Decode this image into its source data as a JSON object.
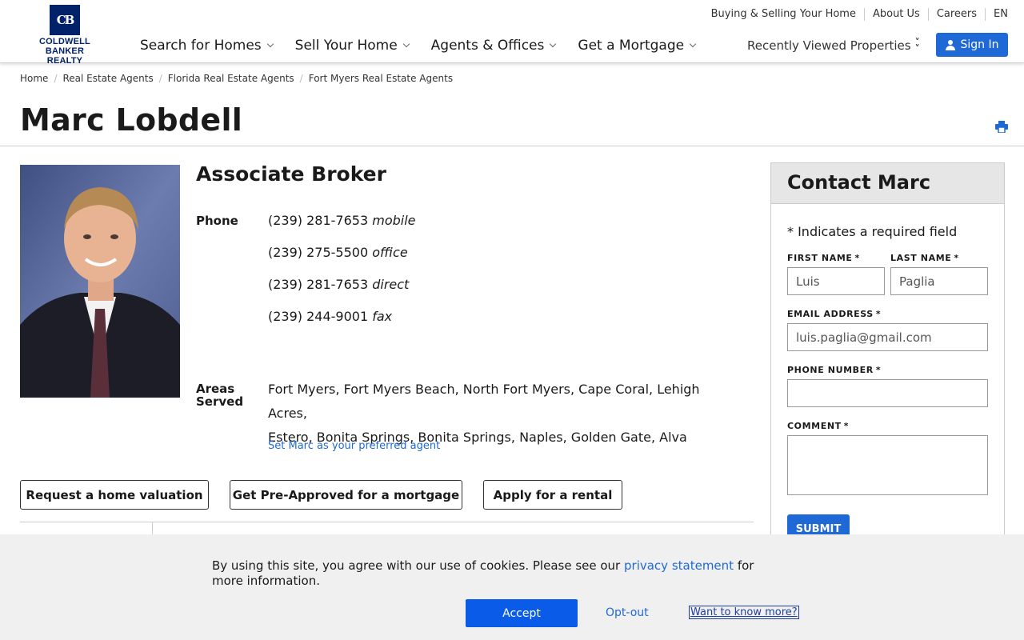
{
  "brand": {
    "monogram": "CB",
    "line1": "COLDWELL BANKER",
    "line2": "REALTY",
    "color": "#012169"
  },
  "util_nav": [
    "Buying & Selling Your Home",
    "About Us",
    "Careers",
    "EN"
  ],
  "main_nav": [
    "Search for Homes",
    "Sell Your Home",
    "Agents & Offices",
    "Get a Mortgage"
  ],
  "recently_viewed": "Recently Viewed Properties",
  "sign_in": "Sign In",
  "breadcrumb": [
    "Home",
    "Real Estate Agents",
    "Florida Real Estate Agents",
    "Fort Myers Real Estate Agents"
  ],
  "agent": {
    "name": "Marc Lobdell",
    "title": "Associate Broker",
    "phone_label": "Phone",
    "phones": [
      {
        "number": "(239) 281-7653",
        "type": "mobile"
      },
      {
        "number": "(239) 275-5500",
        "type": "office"
      },
      {
        "number": "(239) 281-7653",
        "type": "direct"
      },
      {
        "number": "(239) 244-9001",
        "type": "fax"
      }
    ],
    "areas_label_1": "Areas",
    "areas_label_2": "Served",
    "areas_line1": "Fort Myers, Fort Myers Beach, North Fort Myers, Cape Coral, Lehigh Acres,",
    "areas_line2": "Estero, Bonita Springs, Bonita Springs, Naples, Golden Gate, Alva",
    "preferred_link": "Set Marc as your preferred agent"
  },
  "actions": [
    "Request a home valuation",
    "Get Pre-Approved for a mortgage",
    "Apply for a rental"
  ],
  "contact": {
    "heading": "Contact Marc",
    "required_note": "* Indicates a required field",
    "first_name_label": "FIRST NAME",
    "first_name_value": "Luis",
    "last_name_label": "LAST NAME",
    "last_name_value": "Paglia",
    "email_label": "EMAIL ADDRESS",
    "email_value": "luis.paglia@gmail.com",
    "phone_label": "PHONE NUMBER",
    "phone_value": "",
    "comment_label": "COMMENT",
    "comment_value": "",
    "star": "*",
    "submit": "SUBMIT"
  },
  "cookie": {
    "text_before": "By using this site, you agree with our use of cookies. Please see our ",
    "link": "privacy statement",
    "text_after": " for more information.",
    "accept": "Accept",
    "optout": "Opt-out",
    "know_more": "Want to know more?"
  },
  "colors": {
    "accent": "#1f69d6",
    "brand": "#012169",
    "accept": "#0a5ce8"
  }
}
